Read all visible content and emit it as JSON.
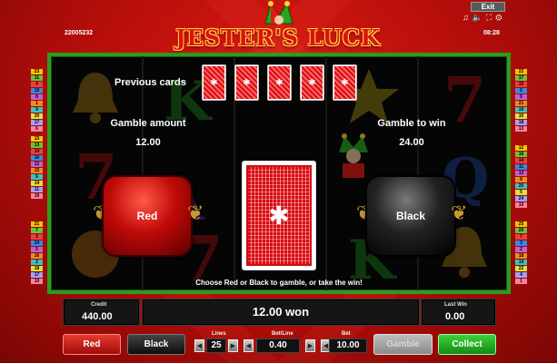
{
  "header": {
    "exit_label": "Exit",
    "icons": [
      "music-icon",
      "speaker-icon",
      "fullscreen-icon",
      "settings-icon"
    ],
    "game_id": "22005232",
    "time": "08:28",
    "logo_text": "JESTER'S LUCK"
  },
  "line_numbers": {
    "left_top": [
      "23",
      "11",
      "4",
      "19",
      "8",
      "1",
      "9",
      "20",
      "17",
      "6"
    ],
    "left_mid": [
      "15",
      "13",
      "14",
      "16",
      "12",
      "15",
      "6",
      "14",
      "11",
      "19"
    ],
    "left_bot": [
      "21",
      "7",
      "3",
      "24",
      "5",
      "16",
      "2",
      "18",
      "17",
      "10"
    ],
    "right_top": [
      "22",
      "17",
      "15",
      "6",
      "9",
      "21",
      "19",
      "10",
      "18",
      "13"
    ],
    "right_mid": [
      "12",
      "16",
      "14",
      "11",
      "13",
      "8",
      "20",
      "5",
      "24",
      "10"
    ],
    "right_bot": [
      "25",
      "20",
      "7",
      "3",
      "2",
      "18",
      "14",
      "22",
      "4",
      "1"
    ]
  },
  "gamble": {
    "previous_cards_label": "Previous cards",
    "previous_cards_count": 5,
    "gamble_amount_label": "Gamble amount",
    "gamble_amount_value": "12.00",
    "gamble_to_win_label": "Gamble to win",
    "gamble_to_win_value": "24.00",
    "red_label": "Red",
    "black_label": "Black",
    "hint": "Choose Red or Black to gamble, or take the win!"
  },
  "panel": {
    "credit_label": "Credit",
    "credit_value": "440.00",
    "won_text": "12.00 won",
    "last_win_label": "Last Win",
    "last_win_value": "0.00"
  },
  "controls": {
    "red_label": "Red",
    "black_label": "Black",
    "lines_label": "Lines",
    "lines_value": "25",
    "bet_line_label": "Bet/Line",
    "bet_line_value": "0.40",
    "bet_label": "Bet",
    "bet_value": "10.00",
    "gamble_label": "Gamble",
    "collect_label": "Collect"
  },
  "colors": {
    "background": "#c2100c",
    "reel_border": "#2f9a1d",
    "collect_green": "#1faa1c"
  }
}
